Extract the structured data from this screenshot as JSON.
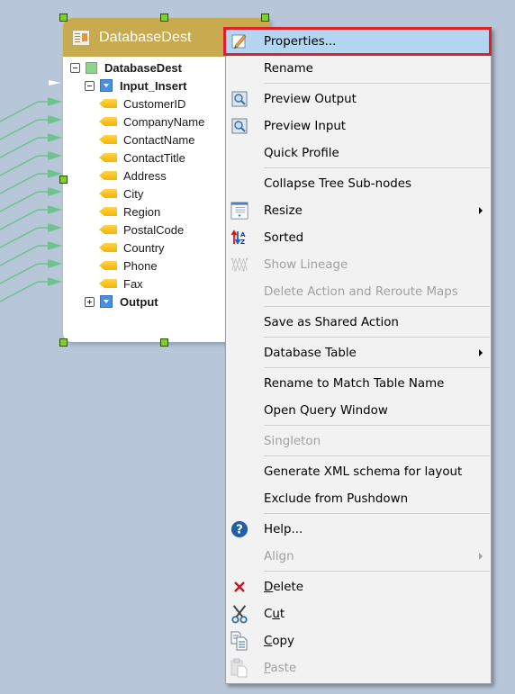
{
  "canvas": {
    "background": "#b7c6d8",
    "connector_color": "#6cc48c",
    "connector_count": 11
  },
  "node": {
    "title": "DatabaseDest",
    "header_icon": "database-dest-icon",
    "tree": {
      "root_label": "DatabaseDest",
      "input_group": {
        "label": "Input_Insert",
        "fields": [
          "CustomerID",
          "CompanyName",
          "ContactName",
          "ContactTitle",
          "Address",
          "City",
          "Region",
          "PostalCode",
          "Country",
          "Phone",
          "Fax"
        ]
      },
      "output_group": {
        "label": "Output"
      }
    }
  },
  "context_menu": {
    "items": [
      {
        "label": "Properties...",
        "icon": "pencil-edit-icon",
        "highlighted": true
      },
      {
        "label": "Rename"
      },
      {
        "separator": true
      },
      {
        "label": "Preview Output",
        "icon": "preview-icon"
      },
      {
        "label": "Preview Input",
        "icon": "preview-icon"
      },
      {
        "label": "Quick Profile"
      },
      {
        "separator": true
      },
      {
        "label": "Collapse Tree Sub-nodes"
      },
      {
        "label": "Resize",
        "icon": "resize-icon",
        "submenu": true
      },
      {
        "label": "Sorted",
        "icon": "sort-az-icon"
      },
      {
        "label": "Show Lineage",
        "icon": "lineage-icon",
        "disabled": true
      },
      {
        "label": "Delete Action and Reroute Maps",
        "disabled": true
      },
      {
        "separator": true
      },
      {
        "label": "Save as Shared Action"
      },
      {
        "separator": true
      },
      {
        "label": "Database Table",
        "submenu": true
      },
      {
        "separator": true
      },
      {
        "label": "Rename to Match Table Name"
      },
      {
        "label": "Open Query Window"
      },
      {
        "separator": true
      },
      {
        "label": "Singleton",
        "disabled": true
      },
      {
        "separator": true
      },
      {
        "label": "Generate XML schema for layout"
      },
      {
        "label": "Exclude from Pushdown"
      },
      {
        "separator": true
      },
      {
        "label": "Help...",
        "icon": "help-icon"
      },
      {
        "label": "Align",
        "disabled": true,
        "submenu": true
      },
      {
        "separator": true
      },
      {
        "label": "Delete",
        "icon": "delete-x-icon",
        "accel": "D"
      },
      {
        "label": "Cut",
        "icon": "scissors-icon",
        "accel": "u"
      },
      {
        "label": "Copy",
        "icon": "copy-icon",
        "accel": "C"
      },
      {
        "label": "Paste",
        "icon": "paste-icon",
        "accel": "P",
        "disabled": true
      }
    ]
  }
}
